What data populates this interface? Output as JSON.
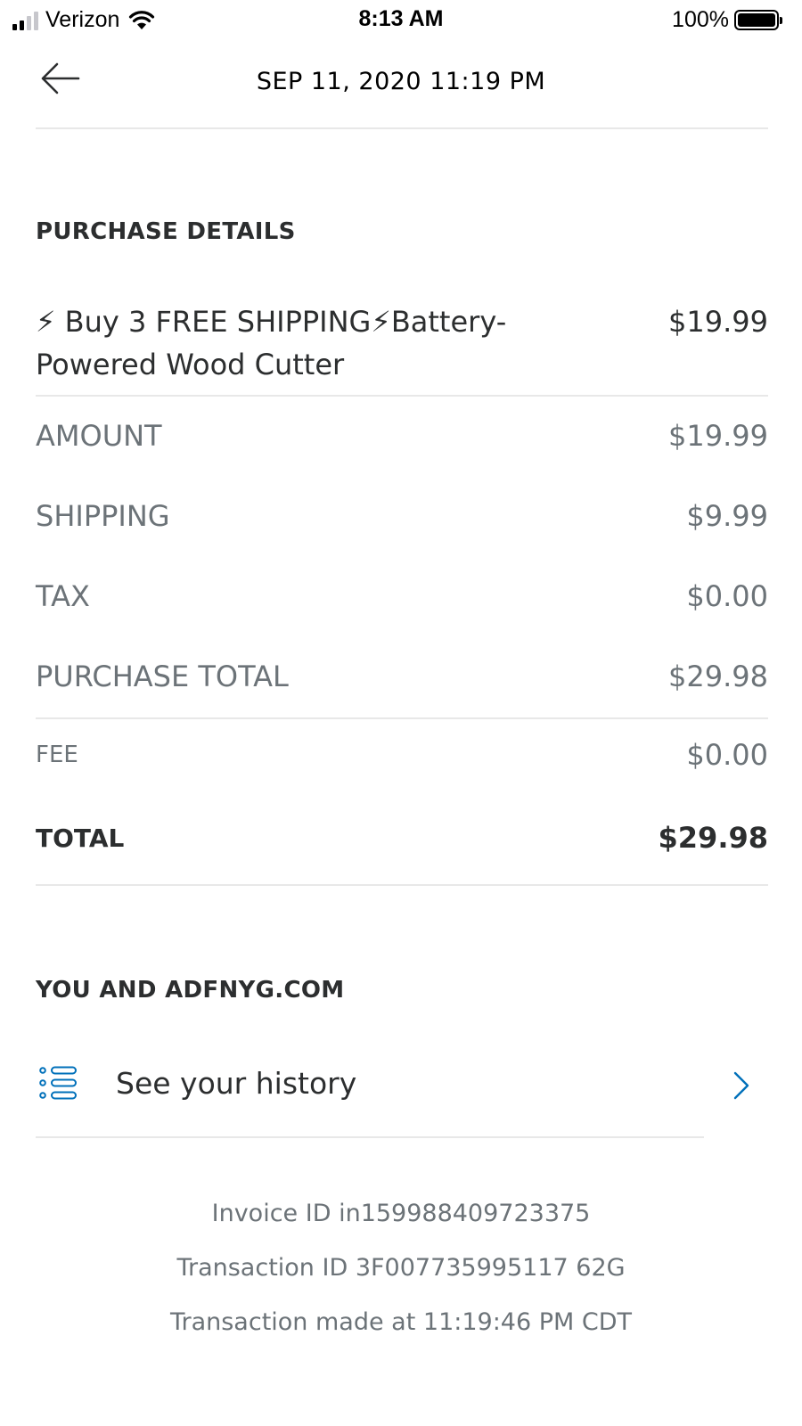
{
  "status_bar": {
    "carrier": "Verizon",
    "time": "8:13 AM",
    "battery": "100%"
  },
  "header": {
    "title": "SEP 11, 2020  11:19 PM"
  },
  "purchase": {
    "section_title": "PURCHASE DETAILS",
    "item_name": "⚡ Buy 3 FREE SHIPPING⚡Battery-Powered Wood Cutter",
    "item_price": "$19.99",
    "amount_label": "AMOUNT",
    "amount_value": "$19.99",
    "shipping_label": "SHIPPING",
    "shipping_value": "$9.99",
    "tax_label": "TAX",
    "tax_value": "$0.00",
    "purchase_total_label": "PURCHASE TOTAL",
    "purchase_total_value": "$29.98",
    "fee_label": "FEE",
    "fee_value": "$0.00",
    "total_label": "TOTAL",
    "total_value": "$29.98"
  },
  "merchant": {
    "section_title": "YOU AND ADFNYG.COM",
    "history_label": "See your history"
  },
  "footer": {
    "invoice": "Invoice ID in159988409723375",
    "transaction": "Transaction ID 3F007735995117 62G",
    "made_at": "Transaction made at 11:19:46 PM CDT"
  },
  "colors": {
    "accent": "#0070ba",
    "text_dark": "#2c2e2f",
    "text_muted": "#6c7378",
    "divider": "#e8e8e8"
  },
  "icons": [
    "back-arrow-icon",
    "history-list-icon",
    "chevron-right-icon",
    "wifi-icon",
    "battery-icon",
    "signal-icon"
  ]
}
